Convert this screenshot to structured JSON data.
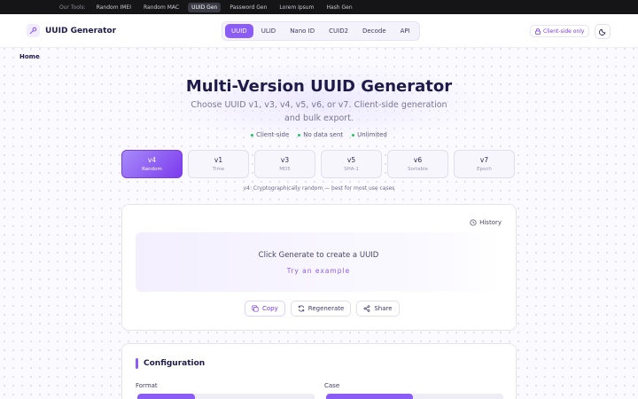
{
  "toolbar": {
    "label": "Our Tools:",
    "tools": [
      "Random IMEI",
      "Random MAC",
      "UUID Gen",
      "Password Gen",
      "Lorem Ipsum",
      "Hash Gen"
    ],
    "active_tool": "UUID Gen"
  },
  "header": {
    "title": "UUID Generator",
    "nav": [
      "UUID",
      "ULID",
      "Nano ID",
      "CUID2",
      "Decode",
      "API"
    ],
    "active_nav": "UUID",
    "badge": "Client-side only"
  },
  "breadcrumb": "Home",
  "hero": {
    "title": "Multi-Version UUID Generator",
    "subtitle": "Choose UUID v1, v3, v4, v5, v6, or v7. Client-side generation and bulk export.",
    "features": [
      "Client-side",
      "No data sent",
      "Unlimited"
    ]
  },
  "versions": [
    {
      "v": "v4",
      "desc": "Random"
    },
    {
      "v": "v1",
      "desc": "Time"
    },
    {
      "v": "v3",
      "desc": "MD5"
    },
    {
      "v": "v5",
      "desc": "SHA-1"
    },
    {
      "v": "v6",
      "desc": "Sortable"
    },
    {
      "v": "v7",
      "desc": "Epoch"
    }
  ],
  "active_version": "v4",
  "version_note": "v4: Cryptographically random — best for most use cases",
  "generator": {
    "history": "History",
    "placeholder": "Click Generate to create a UUID",
    "example_link": "Try an example",
    "copy": "Copy",
    "regenerate": "Regenerate",
    "share": "Share"
  },
  "config": {
    "title": "Configuration",
    "format_label": "Format",
    "case_label": "Case"
  },
  "colors": {
    "accent": "#8b5cf6",
    "accent_dark": "#7c3aed",
    "feature_dot": "#22c55e",
    "tools_bar": "#151517"
  }
}
